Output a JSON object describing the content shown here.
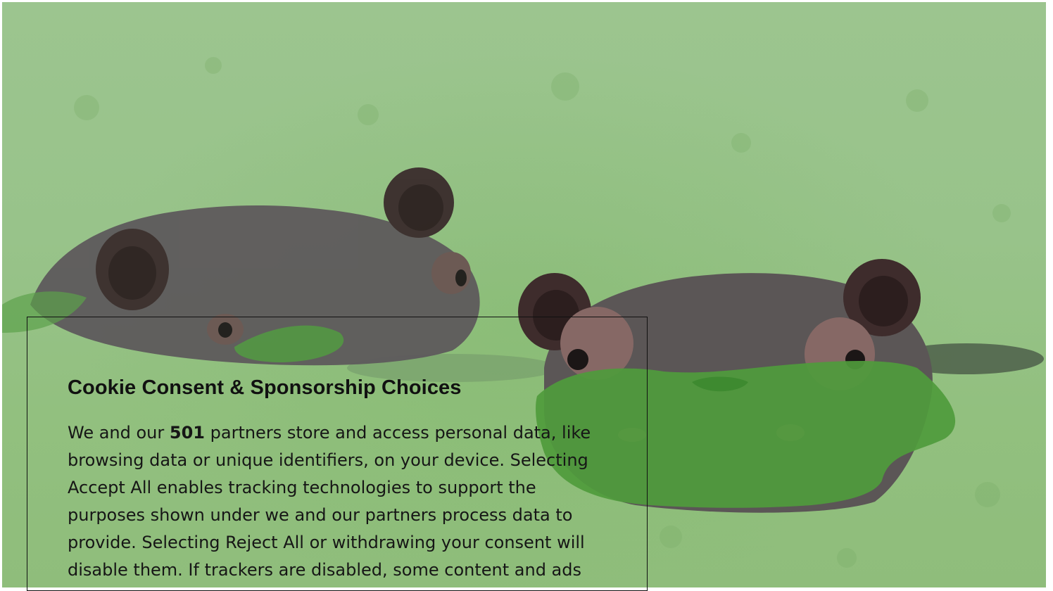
{
  "background": {
    "image_description_icon": "hippos-in-duckweed-photo",
    "colors": {
      "duckweed": "#9cc58f",
      "hippo": "#5b5656",
      "dialog_border": "#111111"
    }
  },
  "consent_dialog": {
    "title": "Cookie Consent & Sponsorship Choices",
    "body_prefix": "We and our ",
    "partner_count": "501",
    "body_suffix": " partners store and access personal data, like browsing data or unique identifiers, on your device. Selecting Accept All enables tracking technologies to support the purposes shown under we and our partners process data to provide. Selecting Reject All or withdrawing your consent will disable them. If trackers are disabled, some content and ads"
  }
}
